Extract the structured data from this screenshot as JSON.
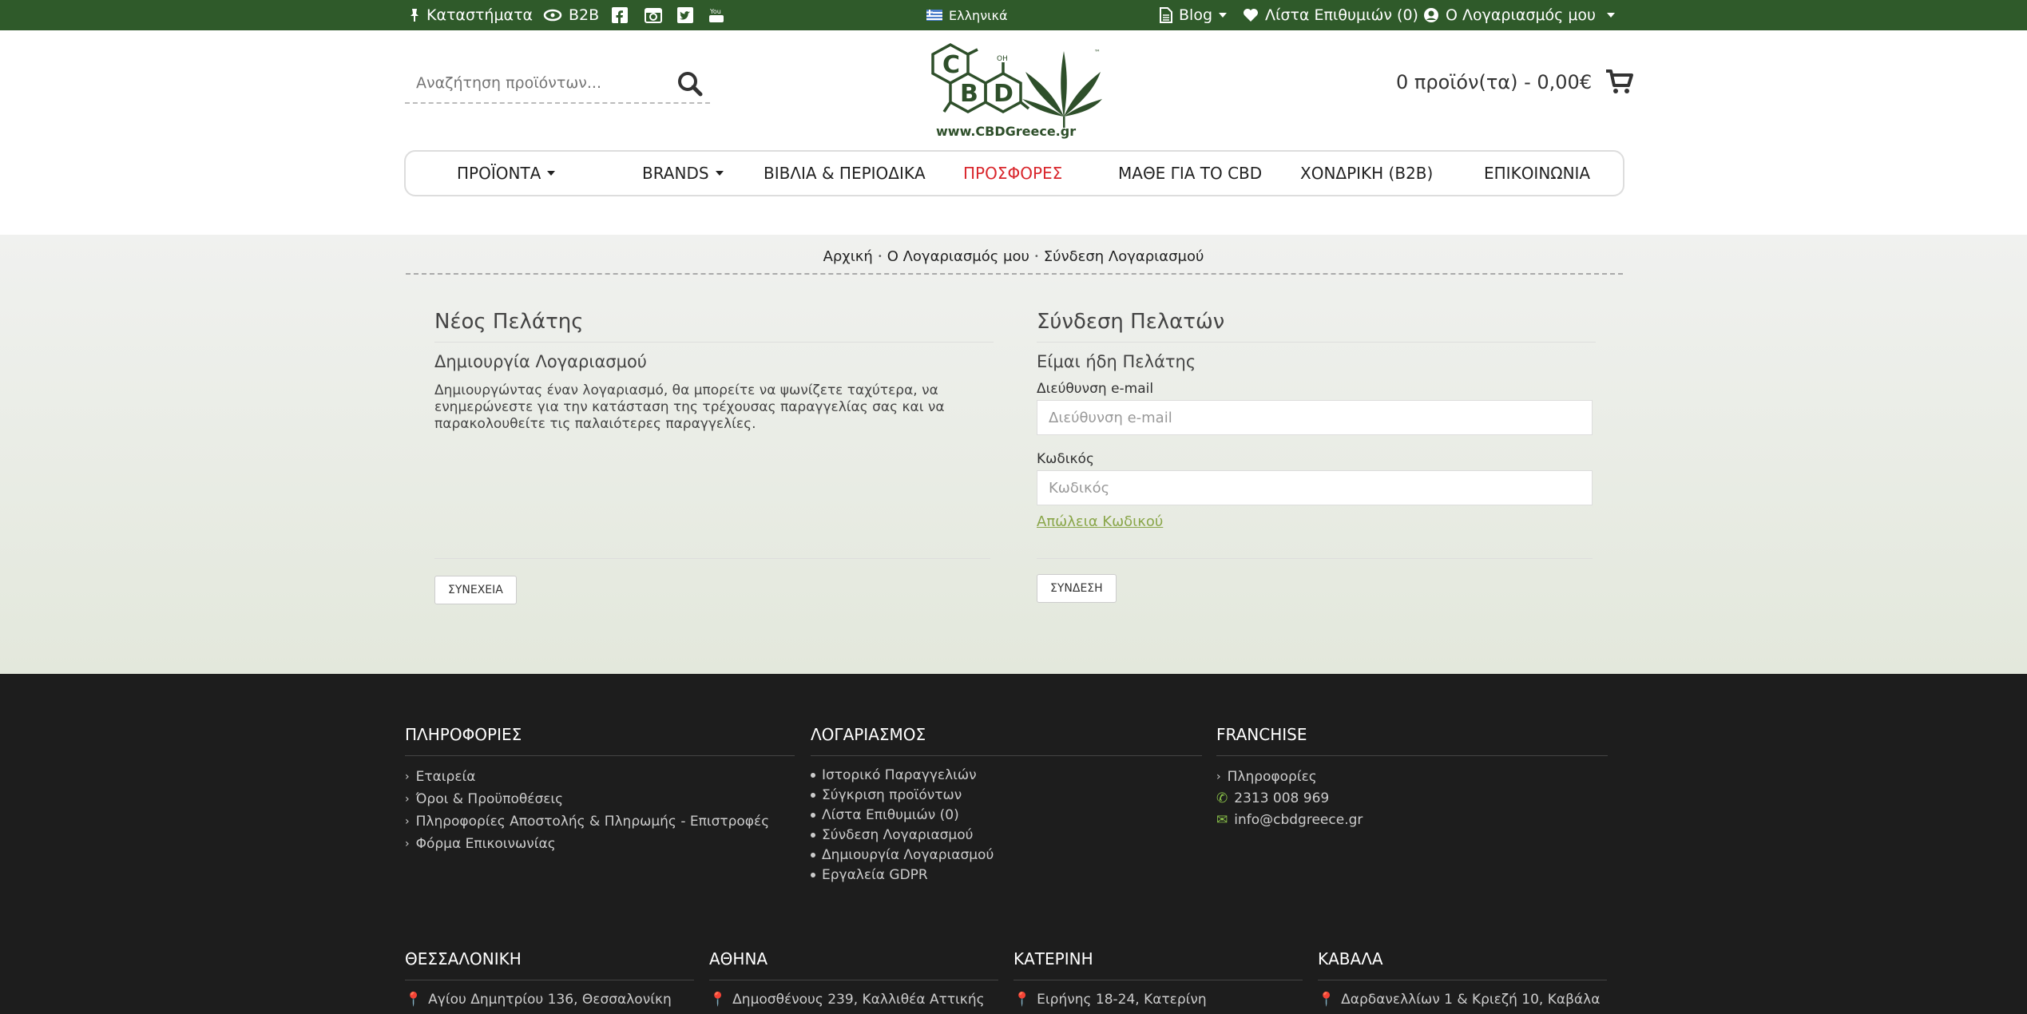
{
  "topbar": {
    "stores": "Καταστήματα",
    "b2b": "B2B",
    "language": "Ελληνικά",
    "blog": "Blog",
    "wishlist": "Λίστα Επιθυμιών (0)",
    "account": "Ο Λογαριασμός μου"
  },
  "header": {
    "search_placeholder": "Αναζήτηση προϊόντων...",
    "logo_text": "www.CBDGreece.gr",
    "cart": "0 προϊόν(τα) - 0,00€"
  },
  "nav": {
    "items": [
      {
        "label": "ΠΡΟΪΟΝΤΑ"
      },
      {
        "label": "BRANDS"
      },
      {
        "label": "ΒΙΒΛΙΑ & ΠΕΡΙΟΔΙΚΑ"
      },
      {
        "label": "ΠΡΟΣΦΟΡΕΣ"
      },
      {
        "label": "ΜΑΘΕ ΓΙΑ ΤΟ CBD"
      },
      {
        "label": "ΧΟΝΔΡΙΚΗ (B2B)"
      },
      {
        "label": "ΕΠΙΚΟΙΝΩΝΙΑ"
      }
    ]
  },
  "breadcrumb": [
    "Αρχική",
    "Ο Λογαριασμός μου",
    "Σύνδεση Λογαριασμού"
  ],
  "new_customer": {
    "title": "Νέος Πελάτης",
    "subtitle": "Δημιουργία Λογαριασμού",
    "text": "Δημιουργώντας έναν λογαριασμό, θα μπορείτε να ψωνίζετε ταχύτερα, να ενημερώνεστε για την κατάσταση της τρέχουσας παραγγελίας σας και να παρακολουθείτε τις παλαιότερες παραγγελίες.",
    "button": "ΣΥΝΕΧΕΙΑ"
  },
  "login": {
    "title": "Σύνδεση Πελατών",
    "subtitle": "Είμαι ήδη Πελάτης",
    "email_label": "Διεύθυνση e-mail",
    "email_placeholder": "Διεύθυνση e-mail",
    "password_label": "Κωδικός",
    "password_placeholder": "Κωδικός",
    "forgot": "Απώλεια Κωδικού",
    "button": "ΣΥΝΔΕΣΗ"
  },
  "footer": {
    "info": {
      "title": "ΠΛΗΡΟΦΟΡΙΕΣ",
      "links": [
        "Εταιρεία",
        "Όροι & Προϋποθέσεις",
        "Πληροφορίες Αποστολής & Πληρωμής - Επιστροφές",
        "Φόρμα Επικοινωνίας"
      ]
    },
    "account": {
      "title": "ΛΟΓΑΡΙΑΣΜΟΣ",
      "links": [
        "Ιστορικό Παραγγελιών",
        "Σύγκριση προϊόντων",
        "Λίστα Επιθυμιών (0)",
        "Σύνδεση Λογαριασμού",
        "Δημιουργία Λογαριασμού",
        "Εργαλεία GDPR"
      ]
    },
    "franchise": {
      "title": "FRANCHISE",
      "info": "Πληροφορίες",
      "phone": "2313 008 969",
      "email": "info@cbdgreece.gr"
    },
    "stores": [
      {
        "city": "ΘΕΣΣΑΛΟΝΙΚΗ",
        "address": "Αγίου Δημητρίου 136, Θεσσαλονίκη"
      },
      {
        "city": "ΑΘΗΝΑ",
        "address": "Δημοσθένους 239, Καλλιθέα Αττικής"
      },
      {
        "city": "ΚΑΤΕΡΙΝΗ",
        "address": "Ειρήνης 18-24, Κατερίνη"
      },
      {
        "city": "ΚΑΒΑΛΑ",
        "address": "Δαρδανελλίων 1 & Κριεζή 10, Καβάλα"
      }
    ]
  },
  "colors": {
    "topbar": "#2f5a2a",
    "accent_red": "#d9262c",
    "link_green": "#8aa64a",
    "footer_bg": "#1d1d1d"
  }
}
